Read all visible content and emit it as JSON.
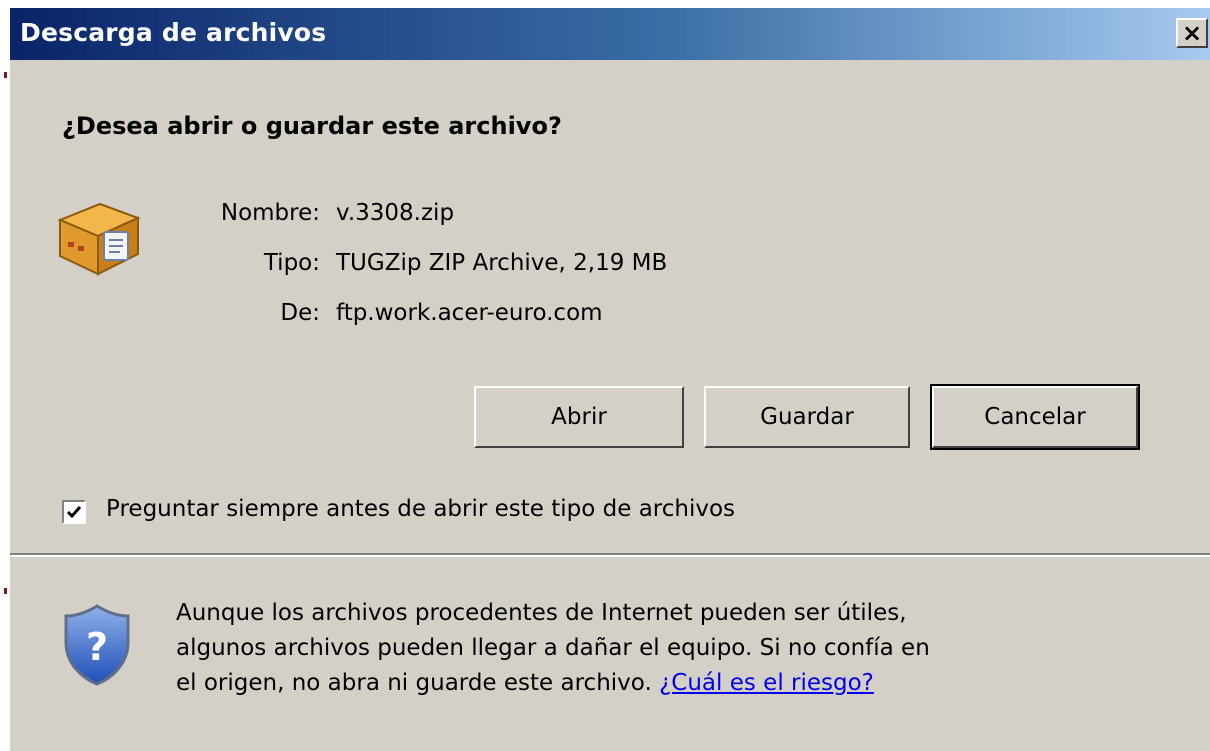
{
  "window": {
    "title": "Descarga de archivos",
    "close_label": "✕",
    "close_glyph": "×"
  },
  "dialog": {
    "question": "¿Desea abrir o guardar este archivo?",
    "file_icon": "package-icon",
    "fields": {
      "name_label": "Nombre:",
      "name_value": "v.3308.zip",
      "type_label": "Tipo:",
      "type_value": "TUGZip ZIP Archive, 2,19 MB",
      "from_label": "De:",
      "from_value": "ftp.work.acer-euro.com"
    },
    "buttons": {
      "open": "Abrir",
      "save": "Guardar",
      "cancel": "Cancelar"
    },
    "checkbox": {
      "checked": true,
      "label": "Preguntar siempre antes de abrir este tipo de archivos"
    },
    "warning": {
      "icon": "shield-question-icon",
      "line1": "Aunque los archivos procedentes de Internet pueden ser útiles,",
      "line2": "algunos archivos pueden llegar a dañar el equipo. Si no confía en",
      "line3_text": "el origen, no abra ni guarde este archivo.",
      "risk_link": "¿Cuál es el riesgo?"
    }
  },
  "colors": {
    "titlebar_start": "#0a246a",
    "titlebar_end": "#a6caf0",
    "dialog_bg": "#d4d0c8",
    "link": "#0000ee"
  }
}
